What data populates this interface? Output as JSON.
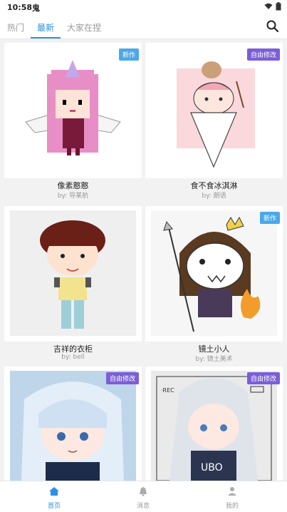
{
  "status": {
    "time": "10:58",
    "app_icon": "鬼"
  },
  "tabs": [
    {
      "label": "热门"
    },
    {
      "label": "最新"
    },
    {
      "label": "大家在捏"
    }
  ],
  "cards": [
    {
      "title": "像素憨憨",
      "author": "by: 导某航",
      "badge": "新作",
      "badge_color": "#4aa8e8"
    },
    {
      "title": "食不食冰淇淋",
      "author": "by: 朗语",
      "badge": "自由修改",
      "badge_color": "#7b5fd6"
    },
    {
      "title": "吉祥的衣柜",
      "author": "by: bell",
      "badge": "",
      "badge_color": ""
    },
    {
      "title": "镜土小人",
      "author": "by: 镜土美术",
      "badge": "新作",
      "badge_color": "#4aa8e8"
    },
    {
      "title": "",
      "author": "",
      "badge": "自由修改",
      "badge_color": "#7b5fd6"
    },
    {
      "title": "",
      "author": "",
      "badge": "自由修改",
      "badge_color": "#7b5fd6"
    }
  ],
  "bottom_nav": [
    {
      "label": "首页",
      "icon": "home-icon"
    },
    {
      "label": "消息",
      "icon": "bell-icon"
    },
    {
      "label": "我的",
      "icon": "user-icon"
    }
  ]
}
